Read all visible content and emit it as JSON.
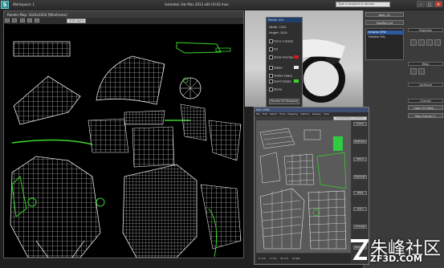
{
  "app": {
    "logo": "S",
    "workspace": "Workspace: 1",
    "title": "Autodesk 3ds Max  2013 x64    UV.02.max",
    "search_placeholder": "Type a keyword or phrase"
  },
  "window_buttons": {
    "minimize": "–",
    "maximize": "□",
    "close": "×"
  },
  "render_window": {
    "title": "Render Map: 1024x1024 [Wireframe]",
    "toolbar_value": "RGB Alpha"
  },
  "render_dialog": {
    "title": "Render UVs",
    "rows": [
      "Width:  1024",
      "Height: 1024",
      "Force 2-Sided",
      "Fill",
      "Show Overlap",
      "Edges",
      "Visible Edges",
      "Seam Edges",
      "Alpha"
    ],
    "button": "Render UV Template"
  },
  "command_panel": {
    "object_name": "Body_01",
    "modifier_list": "Modifier List",
    "stack": [
      "Unwrap UVW",
      "Editable Poly"
    ],
    "rollouts": [
      "Parameters",
      "Selection",
      "Edit UVs",
      "Channel",
      "Peel",
      "Wrap",
      "Projection",
      "Configure"
    ],
    "edit_button": "Open UV Editor ...",
    "map_channel": "Map Channel: 1"
  },
  "uv_editor": {
    "title": "Edit UVWs",
    "menu": [
      "File",
      "Edit",
      "Select",
      "Tools",
      "Mapping",
      "Options",
      "Display",
      "View"
    ],
    "map_label": "CheckerPattern (Checker)",
    "side_sections": [
      "Quick Transform",
      "Reshape Elements",
      "Stitch",
      "Explode",
      "Weld",
      "Peel",
      "Arrange Elements",
      "Element Properties"
    ],
    "bottom_values": [
      "U: 0.0",
      "V: 0.0",
      "W: 0.0",
      "All IDs"
    ]
  },
  "colors": {
    "wire_white": "#e8e8e8",
    "wire_green": "#39d629",
    "background": "#000000",
    "accent_teal": "#2a8c8c"
  },
  "watermark": {
    "text": "朱峰社区",
    "url": "ZF3D.COM"
  }
}
